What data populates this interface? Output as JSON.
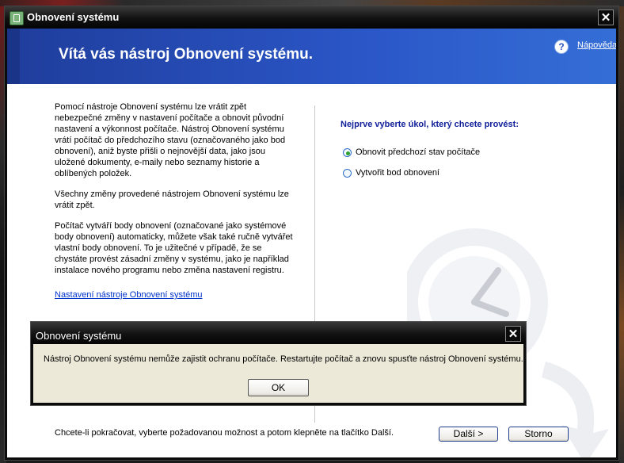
{
  "window": {
    "title": "Obnovení systému"
  },
  "header": {
    "title": "Vítá vás nástroj Obnovení systému.",
    "help_link": "Nápověda"
  },
  "left": {
    "paragraphs": [
      "Pomocí nástroje Obnovení systému lze vrátit zpět nebezpečné změny v nastavení počítače a obnovit původní nastavení a výkonnost počítače. Nástroj Obnovení systému vrátí počítač do předchozího stavu (označovaného jako bod obnovení), aniž byste přišli o nejnovější data, jako jsou uložené dokumenty, e-maily nebo seznamy historie a oblíbených položek.",
      "Všechny změny provedené nástrojem Obnovení systému lze vrátit zpět.",
      "Počítač vytváří body obnovení (označované jako systémové body obnovení) automaticky, můžete však také ručně vytvářet vlastní body obnovení. To je užitečné v případě, že se chystáte provést zásadní změny v systému, jako je například instalace nového programu nebo změna nastavení registru."
    ],
    "settings_link": "Nastavení nástroje Obnovení systému"
  },
  "right": {
    "task_heading": "Nejprve vyberte úkol, který chcete provést:",
    "options": [
      {
        "label": "Obnovit předchozí stav počítače",
        "checked": true
      },
      {
        "label": "Vytvořit bod obnovení",
        "checked": false
      }
    ]
  },
  "footer": {
    "text": "Chcete-li pokračovat, vyberte požadovanou možnost a potom klepněte na tlačítko Další.",
    "next_label": "Další >",
    "cancel_label": "Storno"
  },
  "dialog": {
    "title": "Obnovení systému",
    "message": "Nástroj Obnovení systému nemůže zajistit ochranu počítače. Restartujte počítač a znovu spusťte nástroj Obnovení systému.",
    "ok_label": "OK"
  },
  "colors": {
    "header_blue": "#2b57c8",
    "heading_text": "#13229b",
    "link": "#0033cc"
  }
}
